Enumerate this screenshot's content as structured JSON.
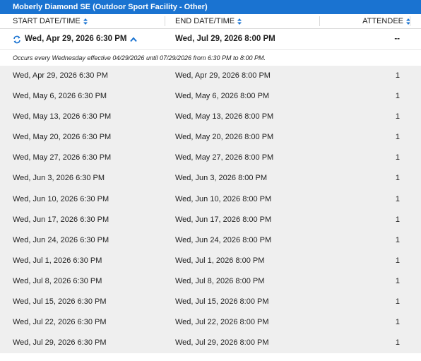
{
  "title": "Moberly Diamond SE (Outdoor Sport Facility - Other)",
  "columns": {
    "start": "START DATE/TIME",
    "end": "END DATE/TIME",
    "attendee": "ATTENDEE"
  },
  "summary": {
    "start": "Wed, Apr 29, 2026 6:30 PM",
    "end": "Wed, Jul 29, 2026 8:00 PM",
    "attendee": "--"
  },
  "recurrence_note": "Occurs every Wednesday effective 04/29/2026 until 07/29/2026 from 6:30 PM to 8:00 PM.",
  "occurrences": [
    {
      "start": "Wed, Apr 29, 2026 6:30 PM",
      "end": "Wed, Apr 29, 2026 8:00 PM",
      "attendee": "1"
    },
    {
      "start": "Wed, May 6, 2026 6:30 PM",
      "end": "Wed, May 6, 2026 8:00 PM",
      "attendee": "1"
    },
    {
      "start": "Wed, May 13, 2026 6:30 PM",
      "end": "Wed, May 13, 2026 8:00 PM",
      "attendee": "1"
    },
    {
      "start": "Wed, May 20, 2026 6:30 PM",
      "end": "Wed, May 20, 2026 8:00 PM",
      "attendee": "1"
    },
    {
      "start": "Wed, May 27, 2026 6:30 PM",
      "end": "Wed, May 27, 2026 8:00 PM",
      "attendee": "1"
    },
    {
      "start": "Wed, Jun 3, 2026 6:30 PM",
      "end": "Wed, Jun 3, 2026 8:00 PM",
      "attendee": "1"
    },
    {
      "start": "Wed, Jun 10, 2026 6:30 PM",
      "end": "Wed, Jun 10, 2026 8:00 PM",
      "attendee": "1"
    },
    {
      "start": "Wed, Jun 17, 2026 6:30 PM",
      "end": "Wed, Jun 17, 2026 8:00 PM",
      "attendee": "1"
    },
    {
      "start": "Wed, Jun 24, 2026 6:30 PM",
      "end": "Wed, Jun 24, 2026 8:00 PM",
      "attendee": "1"
    },
    {
      "start": "Wed, Jul 1, 2026 6:30 PM",
      "end": "Wed, Jul 1, 2026 8:00 PM",
      "attendee": "1"
    },
    {
      "start": "Wed, Jul 8, 2026 6:30 PM",
      "end": "Wed, Jul 8, 2026 8:00 PM",
      "attendee": "1"
    },
    {
      "start": "Wed, Jul 15, 2026 6:30 PM",
      "end": "Wed, Jul 15, 2026 8:00 PM",
      "attendee": "1"
    },
    {
      "start": "Wed, Jul 22, 2026 6:30 PM",
      "end": "Wed, Jul 22, 2026 8:00 PM",
      "attendee": "1"
    },
    {
      "start": "Wed, Jul 29, 2026 6:30 PM",
      "end": "Wed, Jul 29, 2026 8:00 PM",
      "attendee": "1"
    }
  ],
  "icons": {
    "recurring": "recurring-icon",
    "collapse": "chevron-up-icon",
    "sort": "sort-icon"
  },
  "colors": {
    "title_bar": "#1a73d1",
    "accent": "#1a73d1",
    "row_background": "#efefef"
  }
}
